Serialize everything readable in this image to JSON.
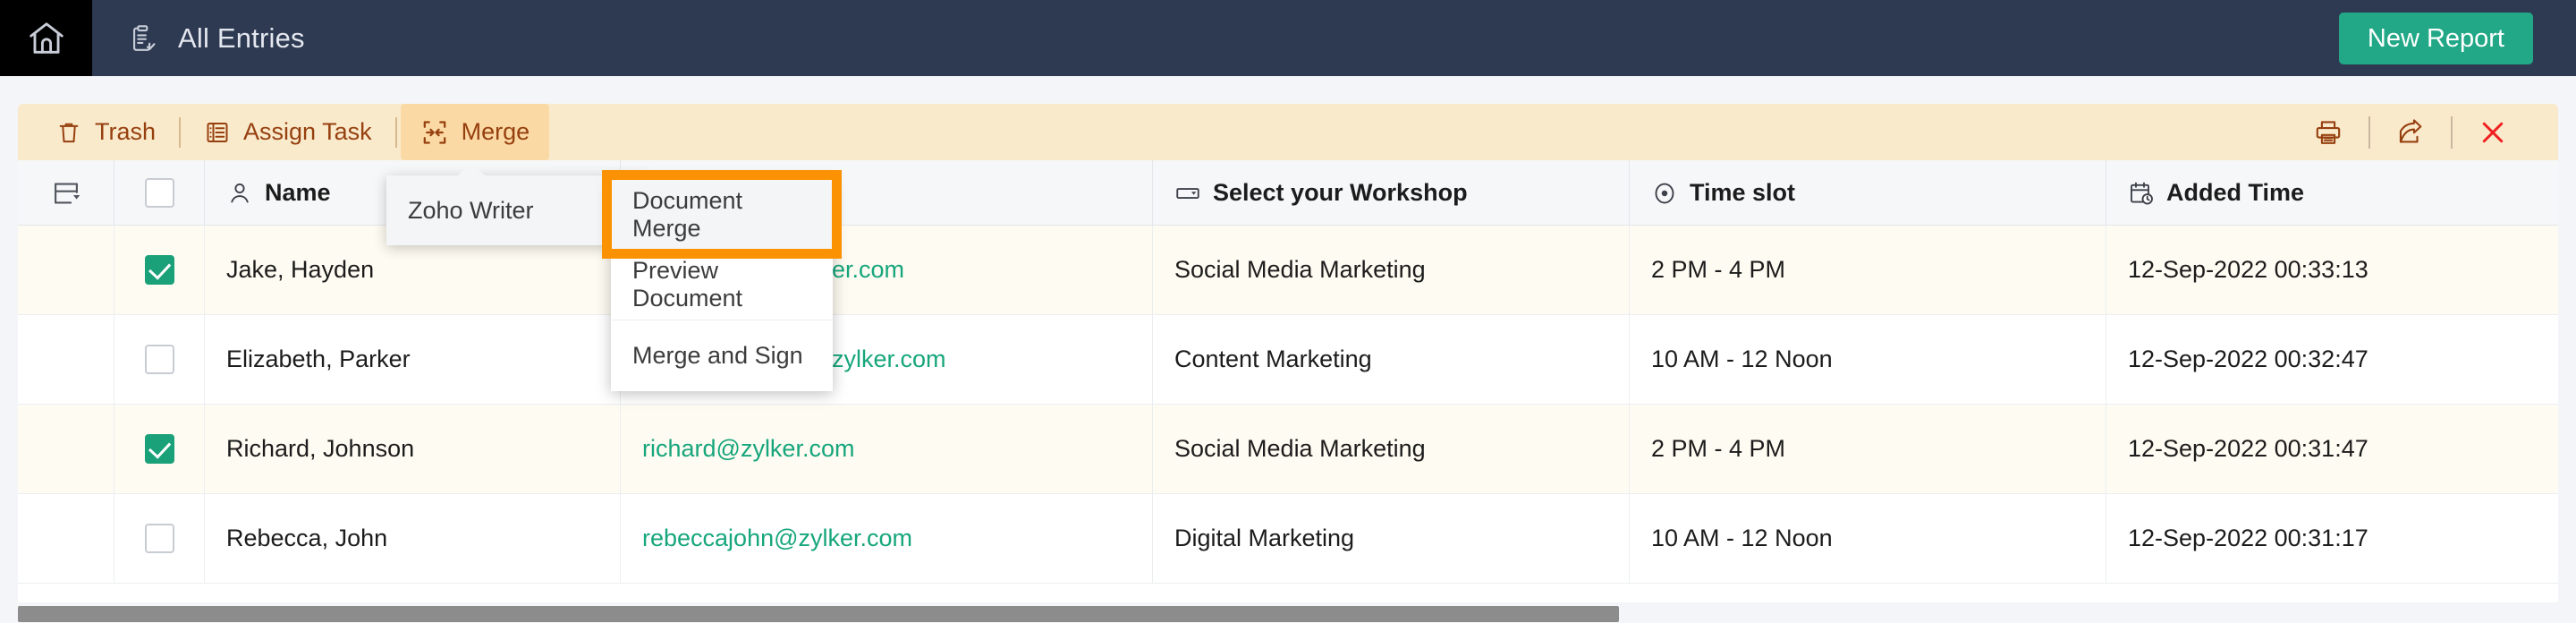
{
  "topbar": {
    "home_icon": "home-icon",
    "entries_icon": "clipboard-check-icon",
    "title": "All Entries",
    "new_report_label": "New Report",
    "bg_color": "#2d3a52",
    "accent_color": "#22a887"
  },
  "toolbar": {
    "bg_color": "#faeacc",
    "text_color": "#96400f",
    "items": [
      {
        "label": "Trash",
        "icon": "trash-icon",
        "active": false
      },
      {
        "label": "Assign Task",
        "icon": "task-list-icon",
        "active": false
      },
      {
        "label": "Merge",
        "icon": "merge-icon",
        "active": true
      }
    ],
    "right_icons": [
      {
        "name": "print-icon"
      },
      {
        "name": "share-icon"
      },
      {
        "name": "close-icon",
        "color": "#f02020"
      }
    ]
  },
  "merge_menu": {
    "level1": [
      {
        "label": "Zoho Writer",
        "has_submenu": true
      }
    ],
    "level2": [
      {
        "label": "Document Merge",
        "focused": true
      },
      {
        "label": "Preview Document",
        "focused": false
      },
      {
        "label": "Merge and Sign",
        "focused": false
      }
    ],
    "focus_outline_color": "#fb9203"
  },
  "table": {
    "columns": [
      {
        "key": "handle",
        "label": "",
        "icon": "column-layout-icon"
      },
      {
        "key": "check",
        "label": "",
        "icon": "select-all-checkbox"
      },
      {
        "key": "name",
        "label": "Name",
        "icon": "person-icon"
      },
      {
        "key": "email",
        "label": "",
        "icon": "email-icon"
      },
      {
        "key": "shop",
        "label": "Select your Workshop",
        "icon": "dropdown-field-icon"
      },
      {
        "key": "slot",
        "label": "Time slot",
        "icon": "radio-field-icon"
      },
      {
        "key": "added",
        "label": "Added Time",
        "icon": "calendar-clock-icon"
      }
    ],
    "rows": [
      {
        "selected": true,
        "name": "Jake, Hayden",
        "email": "jakehayden@zylker.com",
        "workshop": "Social Media Marketing",
        "time_slot": "2 PM - 4 PM",
        "added_time": "12-Sep-2022 00:33:13"
      },
      {
        "selected": false,
        "name": "Elizabeth, Parker",
        "email": "elizabethparker@zylker.com",
        "workshop": "Content Marketing",
        "time_slot": "10 AM - 12 Noon",
        "added_time": "12-Sep-2022 00:32:47"
      },
      {
        "selected": true,
        "name": "Richard, Johnson",
        "email": "richard@zylker.com",
        "workshop": "Social Media Marketing",
        "time_slot": "2 PM - 4 PM",
        "added_time": "12-Sep-2022 00:31:47"
      },
      {
        "selected": false,
        "name": "Rebecca, John",
        "email": "rebeccajohn@zylker.com",
        "workshop": "Digital Marketing",
        "time_slot": "10 AM - 12 Noon",
        "added_time": "12-Sep-2022 00:31:17"
      }
    ],
    "link_color": "#17a67c",
    "selected_row_bg": "#fefbf2"
  },
  "scrollbar": {
    "orientation": "horizontal",
    "thumb_color": "#8c8c8c"
  }
}
